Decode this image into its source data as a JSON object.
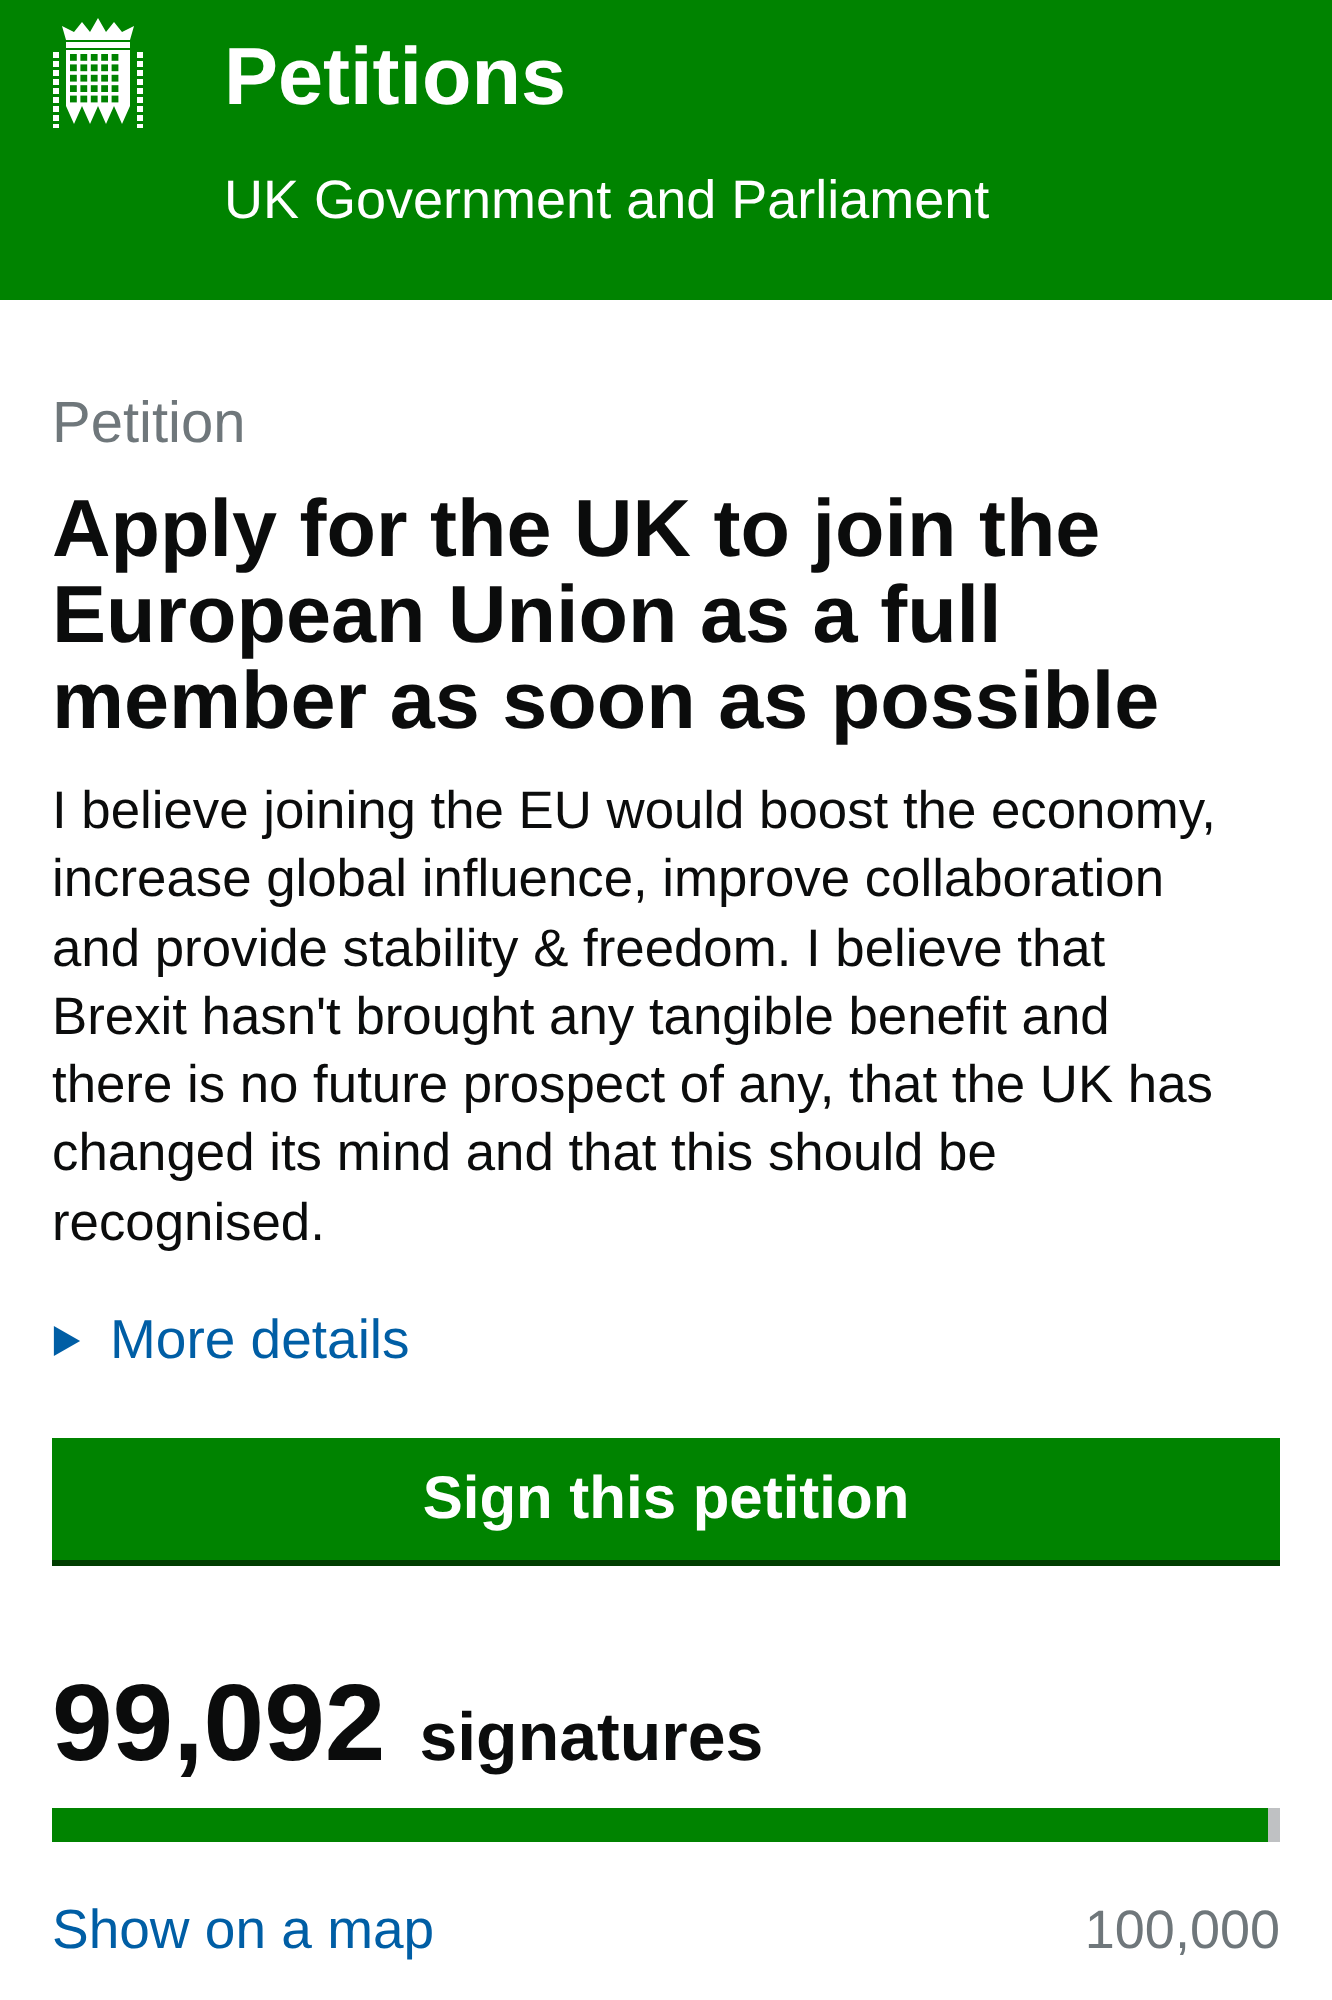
{
  "header": {
    "title": "Petitions",
    "subtitle": "UK Government and Parliament"
  },
  "petition": {
    "label": "Petition",
    "title": "Apply for the UK to join the European Union as a full member as soon as possible",
    "description": "I believe joining the EU would boost the economy, increase global influence, improve collaboration and provide stability & freedom. I believe that Brexit hasn't brought any tangible benefit and there is no future prospect of any, that the UK has changed its mind and that this should be recognised.",
    "more_details": {
      "label": "More details",
      "expanded": false
    }
  },
  "sign_button": "Sign this petition",
  "signatures": {
    "count": "99,092",
    "unit": "signatures",
    "level": 0.99092,
    "map_link": "Show on a map",
    "target": "100,000"
  }
}
